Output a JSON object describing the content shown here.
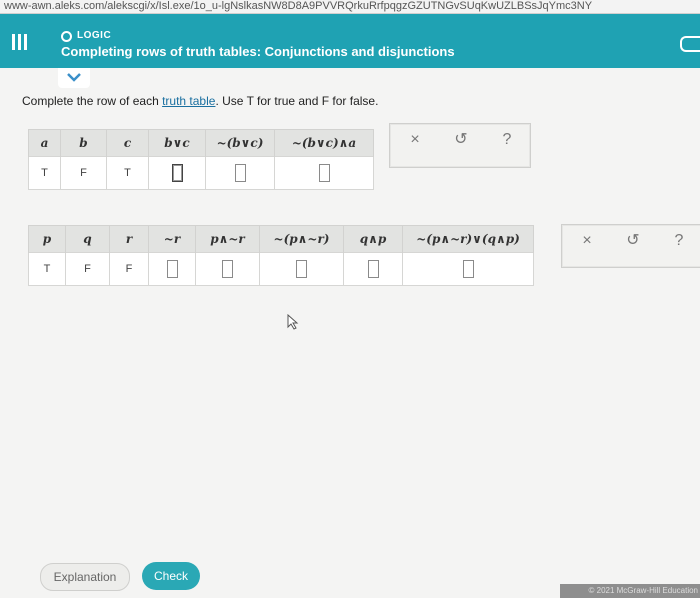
{
  "browser": {
    "url": "www-awn.aleks.com/alekscgi/x/Isl.exe/1o_u-lgNslkasNW8D8A9PVVRQrkuRrfpqgzGZUTNGvSUqKwUZLBSsJqYmc3NY"
  },
  "header": {
    "topic": "LOGIC",
    "title": "Completing rows of truth tables: Conjunctions and disjunctions"
  },
  "instructions": {
    "before": "Complete the row of each ",
    "link": "truth table",
    "after": ". Use T for true and F for false."
  },
  "table1": {
    "headers": [
      "a",
      "b",
      "c",
      "b∨c",
      "~(b∨c)",
      "~(b∨c)∧a"
    ],
    "row": [
      "T",
      "F",
      "T"
    ]
  },
  "table2": {
    "headers": [
      "p",
      "q",
      "r",
      "~r",
      "p∧~r",
      "~(p∧~r)",
      "q∧p",
      "~(p∧~r)∨(q∧p)"
    ],
    "row": [
      "T",
      "F",
      "F"
    ]
  },
  "actions": {
    "clear": "×",
    "undo": "↺",
    "help": "?"
  },
  "buttons": {
    "explanation": "Explanation",
    "check": "Check"
  },
  "footer": {
    "copyright": "© 2021 McGraw-Hill Education"
  }
}
